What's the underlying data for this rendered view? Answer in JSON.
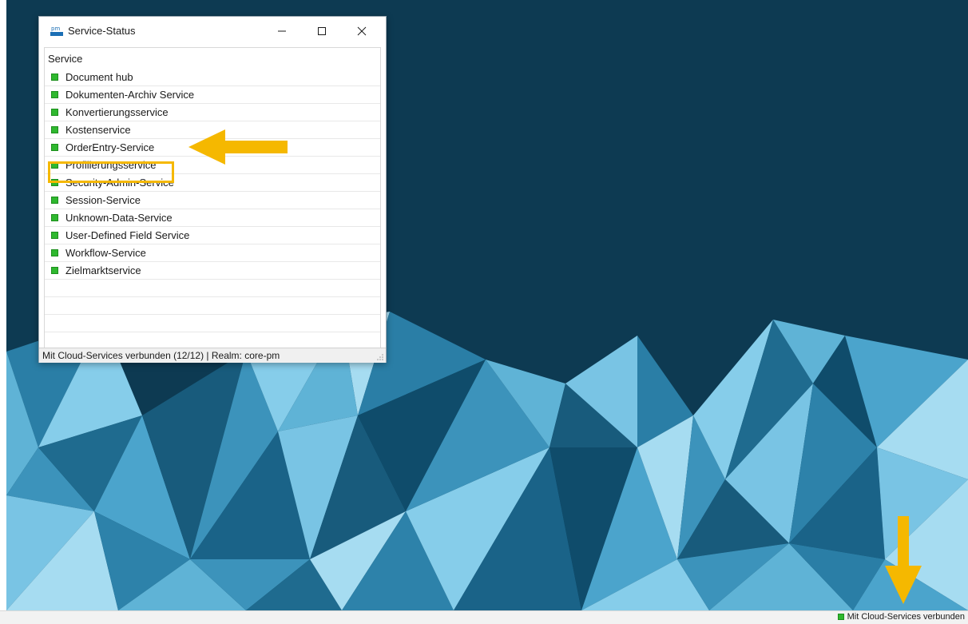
{
  "window": {
    "title": "Service-Status",
    "app_icon": "pm-app-icon",
    "minimize_icon": "minimize-icon",
    "maximize_icon": "maximize-icon",
    "close_icon": "close-icon"
  },
  "list": {
    "header": "Service",
    "status_color": "#2fb82f",
    "items": [
      {
        "label": "Document hub"
      },
      {
        "label": "Dokumenten-Archiv Service"
      },
      {
        "label": "Konvertierungsservice"
      },
      {
        "label": "Kostenservice"
      },
      {
        "label": "OrderEntry-Service"
      },
      {
        "label": "Profilierungsservice"
      },
      {
        "label": "Security-Admin-Service"
      },
      {
        "label": "Session-Service"
      },
      {
        "label": "Unknown-Data-Service"
      },
      {
        "label": "User-Defined Field Service"
      },
      {
        "label": "Workflow-Service"
      },
      {
        "label": "Zielmarktservice"
      }
    ]
  },
  "statusbar": {
    "text": "Mit Cloud-Services verbunden (12/12) | Realm: core-pm"
  },
  "taskbar": {
    "status_text": "Mit Cloud-Services verbunden"
  },
  "annotations": {
    "color": "#f5b800",
    "highlighted_item": "OrderEntry-Service"
  }
}
